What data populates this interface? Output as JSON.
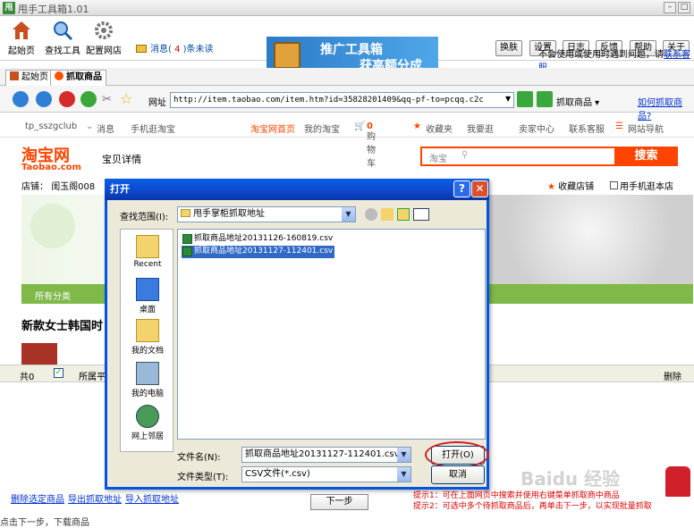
{
  "app": {
    "title": "甩手工具箱1.01"
  },
  "toolbar": {
    "home": "起始页",
    "find_tools": "查找工具",
    "config_shop": "配置网店",
    "notice_prefix": "消息(",
    "notice_count": "4",
    "notice_suffix": ")条未读",
    "banner_line1": "推广工具箱",
    "banner_line2": "获高额分成",
    "skin": "换肤",
    "settings": "设置",
    "log": "日志",
    "feedback": "反馈",
    "help": "帮助",
    "about": "关于",
    "hint_text": "不会使用或使用时遇到问题，请",
    "hint_link": "联系客服"
  },
  "tabs": [
    {
      "label": "起始页"
    },
    {
      "label": "抓取商品"
    }
  ],
  "address": {
    "url_label": "网址",
    "url": "http://item.taobao.com/item.htm?id=35828201409&qq-pf-to=pcqq.c2c",
    "grab_button": "抓取商品",
    "howto_link": "如何抓取商品?"
  },
  "taobao_nav": {
    "user": "tp_sszgclub",
    "message": "消息",
    "mobile": "手机逛淘宝",
    "home": "淘宝网首页",
    "my_taobao": "我的淘宝",
    "cart": "购物车",
    "cart_count": "0",
    "favorites": "收藏夹",
    "buy": "我要逛",
    "seller": "卖家中心",
    "service": "联系客服",
    "sitenav": "网站导航"
  },
  "taobao_head": {
    "logo": "淘宝网",
    "logo_sub": "Taobao.com",
    "section": "宝贝详情",
    "search_scope": "淘宝",
    "search_button": "搜索",
    "shop_label": "店铺：",
    "shop_name": "闺玉阁008",
    "fav_shop": "收藏店铺",
    "mobile_shop": "用手机逛本店",
    "category": "所有分类",
    "product_title": "新款女士韩国时"
  },
  "statusbar": {
    "count": "共0",
    "belong": "所属平",
    "delete": "删除"
  },
  "bottom": {
    "delete_selected": "删除选定商品",
    "export": "导出抓取地址",
    "import": "导入抓取地址",
    "next": "下一步",
    "tip1": "提示1：可在上面网页中搜索并使用右键菜单抓取商中商品",
    "tip2": "提示2：可选中多个待抓取商品后，再单击下一步，以实现批量抓取"
  },
  "footer": {
    "text": "点击下一步，下载商品"
  },
  "watermark": "Baidu 经验",
  "dialog": {
    "title": "打开",
    "lookin_label": "查找范围(I):",
    "lookin_value": "甩手掌柜抓取地址",
    "places": [
      {
        "label": "Recent"
      },
      {
        "label": "桌面"
      },
      {
        "label": "我的文档"
      },
      {
        "label": "我的电脑"
      },
      {
        "label": "网上邻居"
      }
    ],
    "files": [
      {
        "name": "抓取商品地址20131126-160819.csv"
      },
      {
        "name": "抓取商品地址20131127-112401.csv"
      }
    ],
    "filename_label": "文件名(N):",
    "filename_value": "抓取商品地址20131127-112401.csv",
    "filetype_label": "文件类型(T):",
    "filetype_value": "CSV文件(*.csv)",
    "open_button": "打开(O)",
    "cancel_button": "取消"
  }
}
